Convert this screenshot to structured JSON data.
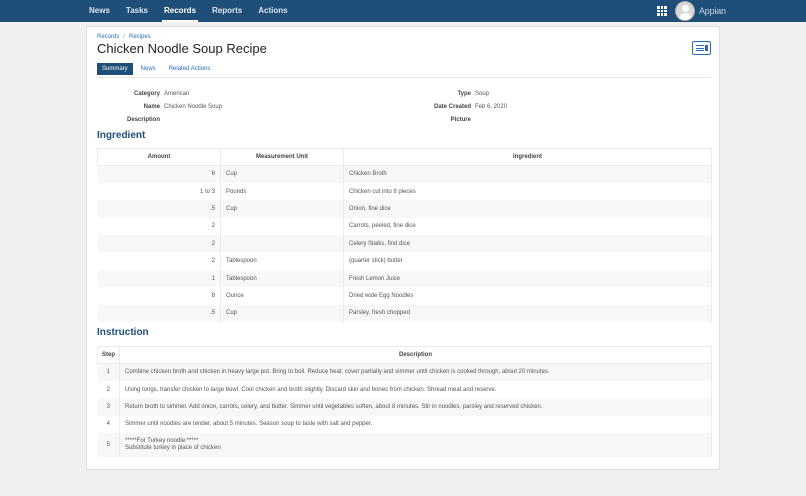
{
  "topnav": {
    "items": [
      "News",
      "Tasks",
      "Records",
      "Reports",
      "Actions"
    ],
    "active": "Records",
    "brand": "Appian"
  },
  "breadcrumb": [
    "Records",
    "Recipes"
  ],
  "title": "Chicken Noodle Soup Recipe",
  "tabs": [
    "Summary",
    "News",
    "Related Actions"
  ],
  "details": {
    "left": [
      {
        "label": "Category",
        "value": "American"
      },
      {
        "label": "Name",
        "value": "Chicken Noodle Soup"
      },
      {
        "label": "Description",
        "value": ""
      }
    ],
    "right": [
      {
        "label": "Type",
        "value": "Soup"
      },
      {
        "label": "Date Created",
        "value": "Feb 6, 2020"
      },
      {
        "label": "Picture",
        "value": ""
      }
    ]
  },
  "ingredients": {
    "heading": "Ingredient",
    "columns": [
      "Amount",
      "Measurement Unit",
      "Ingredient"
    ],
    "rows": [
      [
        "6",
        "Cup",
        "Chicken Broth"
      ],
      [
        "1 to 3",
        "Pounds",
        "Chicken cut into 8 pieces"
      ],
      [
        ".5",
        "Cup",
        "Onion, fine dice"
      ],
      [
        "2",
        "",
        "Carrots, peeled, fine dice"
      ],
      [
        "2",
        "",
        "Celery Stalks, find dice"
      ],
      [
        "2",
        "Tablespoon",
        "(quarter stick) butter"
      ],
      [
        "1",
        "Tablespoon",
        "Fresh Lemon Juice"
      ],
      [
        "8",
        "Ounce",
        "Dried wide Egg Noodles"
      ],
      [
        ".5",
        "Cup",
        "Parsley, fresh chopped"
      ]
    ]
  },
  "instructions": {
    "heading": "Instruction",
    "columns": [
      "Step",
      "Description"
    ],
    "rows": [
      [
        "1",
        "Combine chicken broth and chicken in heavy large pot. Bring to boil. Reduce heat; cover partially and simmer until chicken is cooked through, about 20 minutes."
      ],
      [
        "2",
        "Using tongs, transfer chicken to large bowl. Cool chicken and broth slightly. Discard skin and bones from chicken. Shread meat and reserve."
      ],
      [
        "3",
        "Return broth to simmer. Add onion, carrots, celery, and butter. Simmer until vegetables soften, about 8 minutes. Stir in noodles, parsley and reserved chicken."
      ],
      [
        "4",
        "Simmer until noodles are tender, about 5 minutes. Season soup to taste with salt and pepper."
      ],
      [
        "5",
        "*****For Turkey noodle:*****\nSubstitute turkey in place of chicken"
      ]
    ]
  },
  "icons": {
    "apps": "grid-icon",
    "user": "avatar-icon",
    "record_action": "news-feed-icon"
  },
  "colors": {
    "nav_bg": "#1f4e79",
    "accent": "#2a6ebb",
    "section_heading": "#1f4e79"
  }
}
